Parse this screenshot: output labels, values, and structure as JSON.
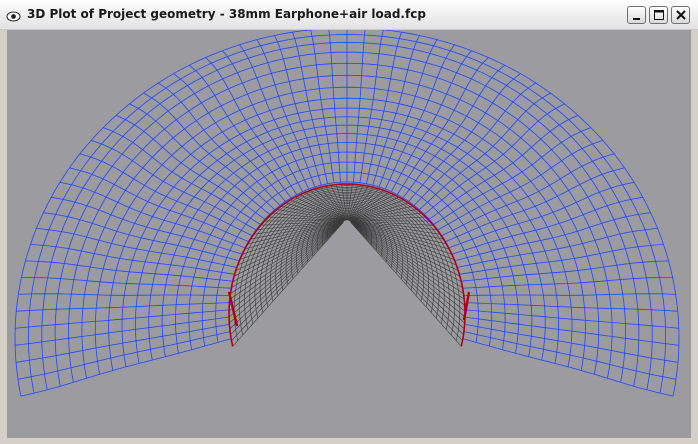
{
  "window": {
    "title": "3D Plot of Project geometry - 38mm Earphone+air load.fcp",
    "icon": "eye-icon",
    "buttons": [
      "minimize-icon",
      "maximize-icon",
      "close-icon"
    ]
  },
  "plot": {
    "background_color": "#9c9b9f",
    "outer_mesh_color": "#1f46ff",
    "inner_mesh_color": "#3a3a3a",
    "rim_color": "#b0001a"
  }
}
